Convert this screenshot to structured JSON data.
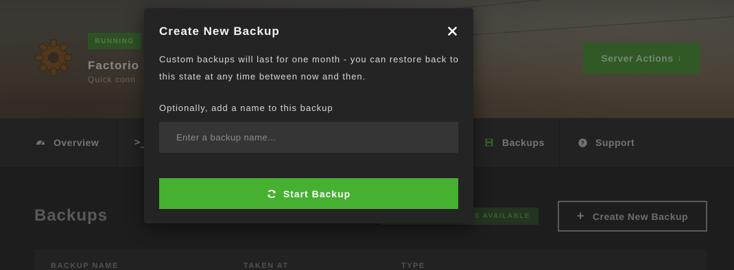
{
  "server": {
    "status_badge": "RUNNING",
    "name": "Factorio",
    "subtitle": "Quick conn",
    "actions_label": "Server Actions",
    "actions_arrow": "↓"
  },
  "nav": {
    "items": [
      {
        "label": "Overview",
        "icon": "dashboard-icon"
      },
      {
        "label": ">_",
        "icon": "console-icon"
      },
      {
        "label": "Backups",
        "icon": "save-icon"
      },
      {
        "label": "Support",
        "icon": "question-icon"
      }
    ]
  },
  "main": {
    "title": "Backups",
    "available_badge": "PS AVAILABLE",
    "create_button": "Create New Backup",
    "table_headers": [
      "BACKUP NAME",
      "TAKEN AT",
      "TYPE"
    ]
  },
  "modal": {
    "title": "Create New Backup",
    "description": "Custom backups will last for one month - you can restore back to this state at any time between now and then.",
    "name_label": "Optionally, add a name to this backup",
    "name_placeholder": "Enter a backup name...",
    "name_value": "",
    "start_button": "Start Backup"
  },
  "colors": {
    "accent_green": "#46b030",
    "modal_bg": "#242424",
    "page_bg": "#2d2d2d"
  }
}
